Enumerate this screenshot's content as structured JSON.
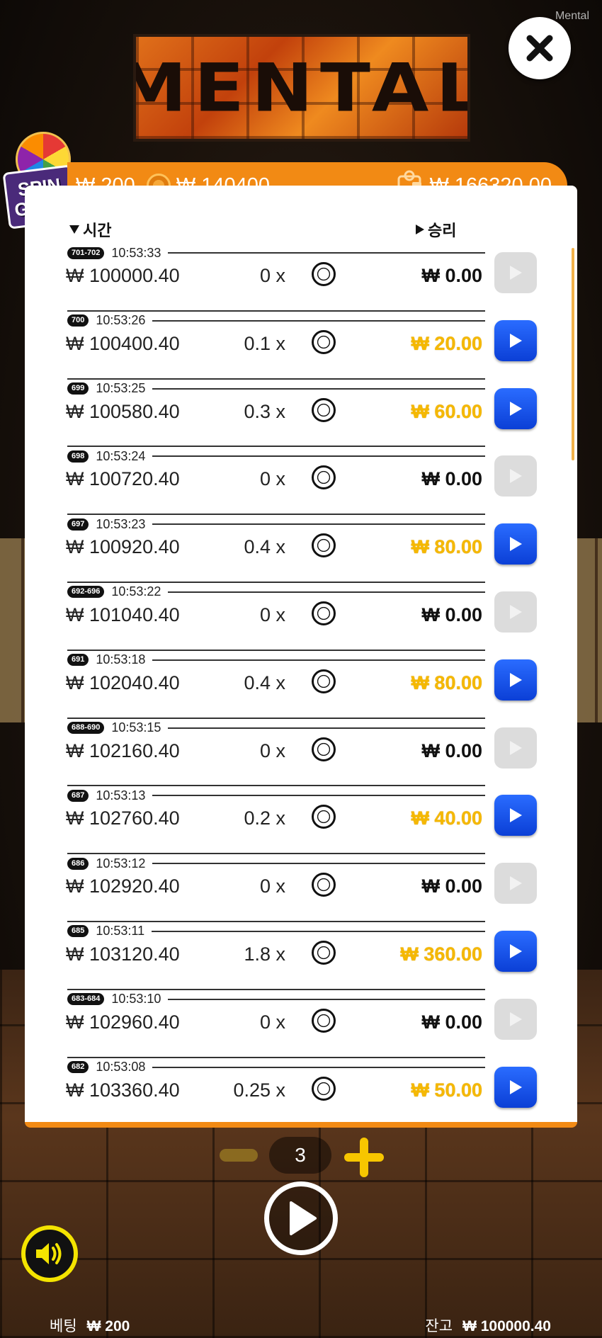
{
  "watermark": "Mental",
  "logo_text": "MENTAL",
  "spin_gifts": {
    "line1": "SPIN",
    "line2": "GIFTS"
  },
  "header": {
    "bet": "₩ 200",
    "coin_value": "₩ 140400",
    "total_win": "₩ 166320.00"
  },
  "columns": {
    "time": "시간",
    "win": "승리"
  },
  "rows": [
    {
      "round": "701-702",
      "time": "10:53:33",
      "amount": "₩ 100000.40",
      "multiplier": "0 x",
      "win": "₩ 0.00",
      "highlight": false
    },
    {
      "round": "700",
      "time": "10:53:26",
      "amount": "₩ 100400.40",
      "multiplier": "0.1 x",
      "win": "₩ 20.00",
      "highlight": true
    },
    {
      "round": "699",
      "time": "10:53:25",
      "amount": "₩ 100580.40",
      "multiplier": "0.3 x",
      "win": "₩ 60.00",
      "highlight": true
    },
    {
      "round": "698",
      "time": "10:53:24",
      "amount": "₩ 100720.40",
      "multiplier": "0 x",
      "win": "₩ 0.00",
      "highlight": false
    },
    {
      "round": "697",
      "time": "10:53:23",
      "amount": "₩ 100920.40",
      "multiplier": "0.4 x",
      "win": "₩ 80.00",
      "highlight": true
    },
    {
      "round": "692-696",
      "time": "10:53:22",
      "amount": "₩ 101040.40",
      "multiplier": "0 x",
      "win": "₩ 0.00",
      "highlight": false
    },
    {
      "round": "691",
      "time": "10:53:18",
      "amount": "₩ 102040.40",
      "multiplier": "0.4 x",
      "win": "₩ 80.00",
      "highlight": true
    },
    {
      "round": "688-690",
      "time": "10:53:15",
      "amount": "₩ 102160.40",
      "multiplier": "0 x",
      "win": "₩ 0.00",
      "highlight": false
    },
    {
      "round": "687",
      "time": "10:53:13",
      "amount": "₩ 102760.40",
      "multiplier": "0.2 x",
      "win": "₩ 40.00",
      "highlight": true
    },
    {
      "round": "686",
      "time": "10:53:12",
      "amount": "₩ 102920.40",
      "multiplier": "0 x",
      "win": "₩ 0.00",
      "highlight": false
    },
    {
      "round": "685",
      "time": "10:53:11",
      "amount": "₩ 103120.40",
      "multiplier": "1.8 x",
      "win": "₩ 360.00",
      "highlight": true
    },
    {
      "round": "683-684",
      "time": "10:53:10",
      "amount": "₩ 102960.40",
      "multiplier": "0 x",
      "win": "₩ 0.00",
      "highlight": false
    },
    {
      "round": "682",
      "time": "10:53:08",
      "amount": "₩ 103360.40",
      "multiplier": "0.25 x",
      "win": "₩ 50.00",
      "highlight": true
    }
  ],
  "stepper": {
    "value": "3"
  },
  "footer": {
    "bet_label": "베팅",
    "bet_value": "₩ 200",
    "balance_label": "잔고",
    "balance_value": "₩ 100000.40"
  },
  "colors": {
    "accent": "#f28a14",
    "win_gold": "#f5b800",
    "play_blue": "#1a4fe8"
  }
}
